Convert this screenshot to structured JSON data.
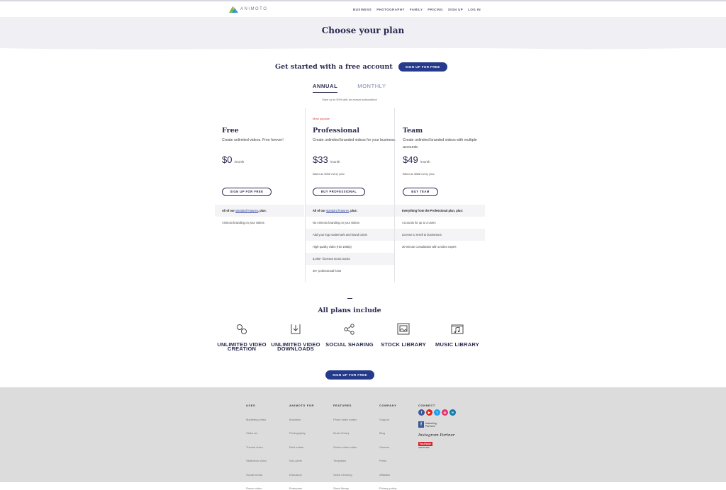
{
  "nav": {
    "logo_text": "ANIMOTO",
    "links": [
      "BUSINESS",
      "PHOTOGRAPHY",
      "FAMILY",
      "PRICING",
      "SIGN UP",
      "LOG IN"
    ]
  },
  "hero": {
    "title": "Choose your plan"
  },
  "free_account": {
    "text": "Get started with a free account",
    "button": "SIGN UP FOR FREE"
  },
  "billing": {
    "tabs": [
      "ANNUAL",
      "MONTHLY"
    ],
    "active": "ANNUAL",
    "note": "Save up to 50% with an annual subscription"
  },
  "plans": [
    {
      "badge": "",
      "name": "Free",
      "desc": "Create unlimited videos. Free forever!",
      "price": "$0",
      "per": "/month",
      "billed": "",
      "button": "SIGN UP FOR FREE"
    },
    {
      "badge": "Most popular!",
      "name": "Professional",
      "desc": "Create unlimited branded videos for your business.",
      "price": "$33",
      "per": "/month",
      "billed": "Billed as $396 every year",
      "button": "BUY PROFESSIONAL"
    },
    {
      "badge": "",
      "name": "Team",
      "desc": "Create unlimited branded videos with multiple accounts.",
      "price": "$49",
      "per": "/month",
      "billed": "Billed as $588 every year",
      "button": "BUY TEAM"
    }
  ],
  "features": {
    "free": {
      "intro_pre": "All of our ",
      "intro_link": "standard features",
      "intro_post": ", plus:",
      "items": [
        "Animoto branding on your videos"
      ]
    },
    "professional": {
      "intro_pre": "All of our ",
      "intro_link": "standard features",
      "intro_post": ", plus:",
      "items": [
        "No Animoto branding on your videos",
        "Add your logo watermark and brand colors",
        "High-quality video (HD 1080p)",
        "3,000+ licensed music tracks",
        "40+ professional fonts"
      ]
    },
    "team": {
      "intro": "Everything from the Professional plan, plus:",
      "items": [
        "Accounts for up to 3 users",
        "License to resell to businesses",
        "30-minute consultation with a video expert"
      ]
    }
  },
  "all_plans": {
    "title": "All plans include",
    "items": [
      {
        "icon": "link-icon",
        "label": "UNLIMITED VIDEO CREATION"
      },
      {
        "icon": "download-icon",
        "label": "UNLIMITED VIDEO DOWNLOADS"
      },
      {
        "icon": "share-icon",
        "label": "SOCIAL SHARING"
      },
      {
        "icon": "image-library-icon",
        "label": "STOCK LIBRARY"
      },
      {
        "icon": "music-folder-icon",
        "label": "MUSIC LIBRARY"
      }
    ],
    "button": "SIGN UP FOR FREE"
  },
  "footer": {
    "columns": [
      {
        "title": "USES",
        "items": [
          "Marketing video",
          "Video ad",
          "Tutorial video",
          "Slideshow video",
          "Social media",
          "Promo video"
        ]
      },
      {
        "title": "ANIMOTO FOR",
        "items": [
          "Business",
          "Photography",
          "Real estate",
          "Non-profit",
          "Education",
          "Enterprise"
        ]
      },
      {
        "title": "FEATURES",
        "items": [
          "Photo video maker",
          "Music library",
          "Online video editor",
          "Templates",
          "Video trimming",
          "Stock library"
        ]
      },
      {
        "title": "COMPANY",
        "items": [
          "Support",
          "Blog",
          "Careers",
          "Press",
          "Affiliates",
          "Privacy policy"
        ]
      }
    ],
    "connect": {
      "title": "CONNECT",
      "social": [
        {
          "icon": "facebook-icon",
          "glyph": "f",
          "color": "#3b5998"
        },
        {
          "icon": "youtube-icon",
          "glyph": "▶",
          "color": "#e62117"
        },
        {
          "icon": "twitter-icon",
          "glyph": "t",
          "color": "#1da1f2"
        },
        {
          "icon": "instagram-icon",
          "glyph": "◎",
          "color": "#e1306c"
        },
        {
          "icon": "linkedin-icon",
          "glyph": "in",
          "color": "#0e76a8"
        }
      ],
      "fb_badge": "Marketing Partners",
      "insta_badge": "Instagram Partner",
      "yt_badge": "YouTube",
      "yt_sub": "CERTIFIED"
    }
  },
  "colors": {
    "primary": "#253a8a",
    "heading": "#2a2b52",
    "popular": "#d23b3b",
    "footer_bg": "#dcdcdc"
  }
}
